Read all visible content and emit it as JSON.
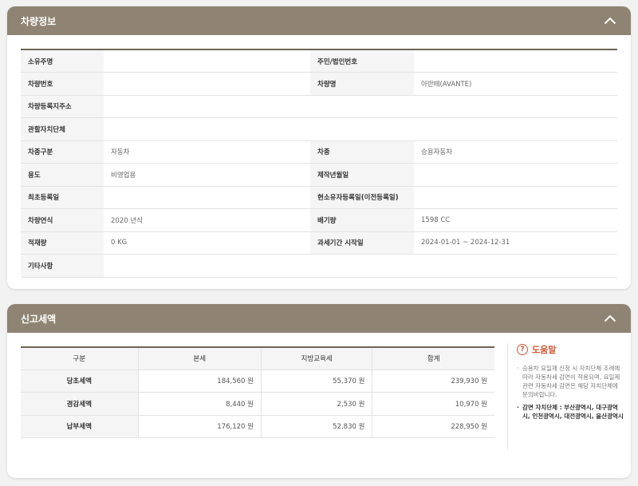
{
  "vehicle_panel": {
    "title": "차량정보",
    "rows": [
      [
        {
          "label": "소유주명",
          "value": ""
        },
        {
          "label": "주민/법인번호",
          "value": ""
        }
      ],
      [
        {
          "label": "차량번호",
          "value": ""
        },
        {
          "label": "차량명",
          "value": "아반떼(AVANTE)"
        }
      ],
      [
        {
          "label": "차량등록지주소",
          "value": ""
        }
      ],
      [
        {
          "label": "관할자치단체",
          "value": ""
        }
      ],
      [
        {
          "label": "차종구분",
          "value": "자동차"
        },
        {
          "label": "차종",
          "value": "승용자동차"
        }
      ],
      [
        {
          "label": "용도",
          "value": "비영업용"
        },
        {
          "label": "제작년월일",
          "value": ""
        }
      ],
      [
        {
          "label": "최초등록일",
          "value": ""
        },
        {
          "label": "현소유자등록일(이전등록일)",
          "value": ""
        }
      ],
      [
        {
          "label": "차량연식",
          "value": "2020 년식"
        },
        {
          "label": "배기량",
          "value": "1598 CC"
        }
      ],
      [
        {
          "label": "적재량",
          "value": "0 KG"
        },
        {
          "label": "과세기간 시작일",
          "value": "2024-01-01 ~ 2024-12-31"
        }
      ],
      [
        {
          "label": "기타사항",
          "value": ""
        }
      ]
    ]
  },
  "tax_panel": {
    "title": "신고세액",
    "headers": [
      "구분",
      "본세",
      "지방교육세",
      "합계"
    ],
    "rows": [
      {
        "label": "당초세액",
        "values": [
          "184,560 원",
          "55,370 원",
          "239,930 원"
        ]
      },
      {
        "label": "경감세액",
        "values": [
          "8,440 원",
          "2,530 원",
          "10,970 원"
        ]
      },
      {
        "label": "납부세액",
        "values": [
          "176,120 원",
          "52,830 원",
          "228,950 원"
        ]
      }
    ]
  },
  "help": {
    "title": "도움말",
    "items": [
      "승용차 요일제 신청 시 자치단체 조례에 따라 자동차세 감면이 적용되며, 요일제 관련 자동차세 감면은 해당 자치단체에 문의바랍니다.",
      "감면 자치단체 : 부산광역시, 대구광역시, 인천광역시, 대전광역시, 울산광역시"
    ]
  },
  "colors": {
    "header_bg": "#8f8473",
    "help_accent": "#d9552e"
  },
  "icons": {
    "collapse": "chevron-up-icon",
    "help": "question-circle-icon"
  }
}
